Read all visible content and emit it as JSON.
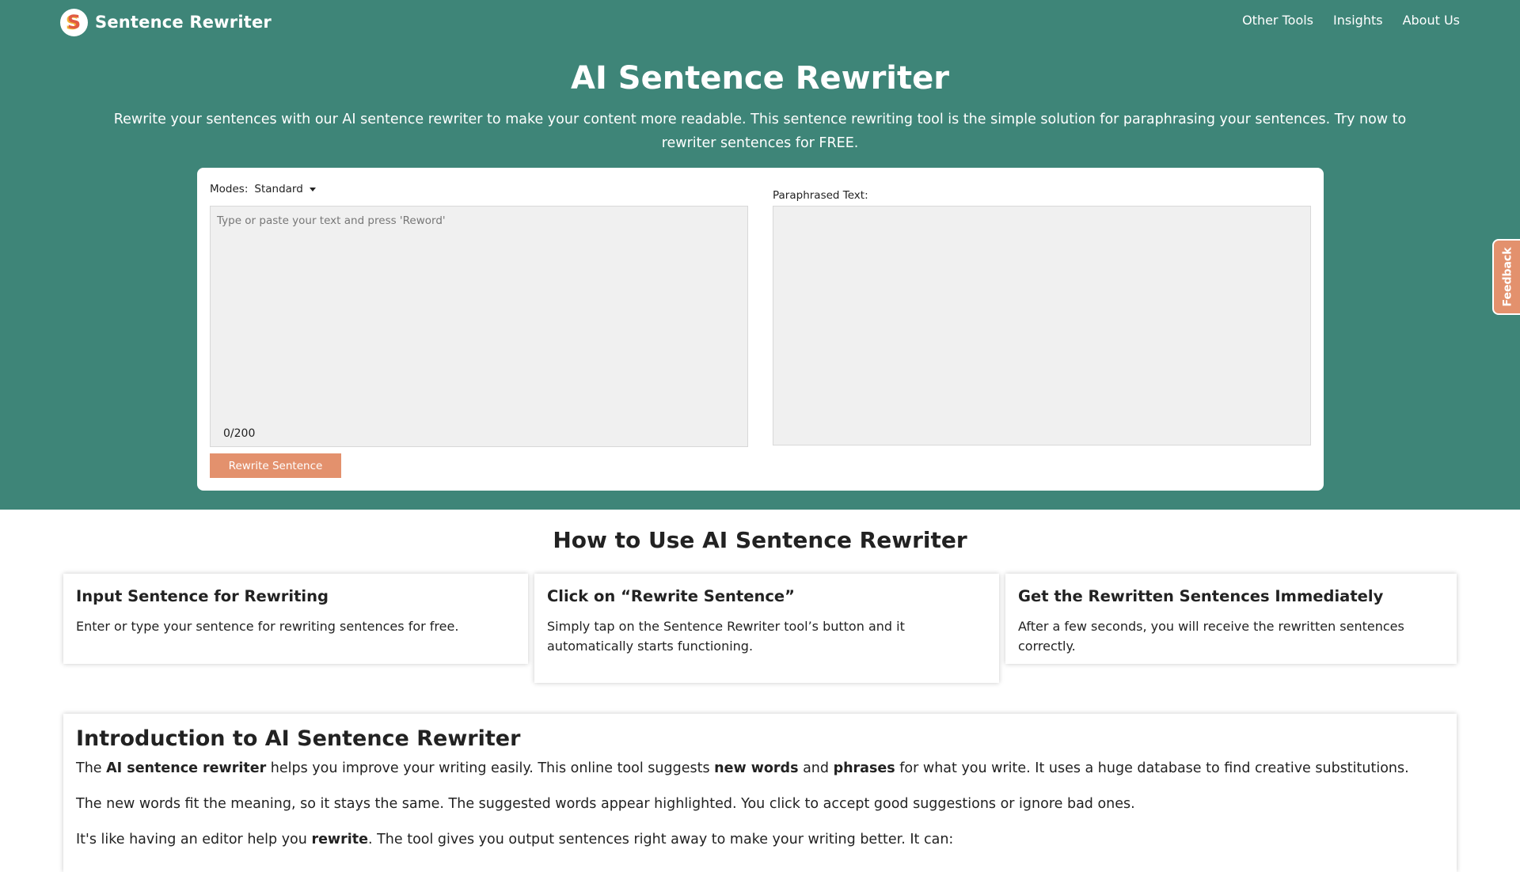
{
  "brand": {
    "logo_letter": "S",
    "name": "Sentence Rewriter"
  },
  "nav": {
    "links": [
      "Other Tools",
      "Insights",
      "About Us"
    ]
  },
  "hero": {
    "title": "AI Sentence Rewriter",
    "subtitle": "Rewrite your sentences with our AI sentence rewriter to make your content more readable. This sentence rewriting tool is the simple solution for paraphrasing your sentences. Try now to rewriter sentences for FREE."
  },
  "tool": {
    "modes_label": "Modes:",
    "mode_value": "Standard",
    "input_placeholder": "Type or paste your text and press 'Reword'",
    "counter": "0/200",
    "output_label": "Paraphrased Text:",
    "rewrite_button": "Rewrite Sentence"
  },
  "feedback": {
    "label": "Feedback"
  },
  "how_to": {
    "title": "How to Use AI Sentence Rewriter",
    "steps": [
      {
        "title": "Input Sentence for Rewriting",
        "text": "Enter or type your sentence for rewriting sentences for free."
      },
      {
        "title": "Click on “Rewrite Sentence”",
        "text": "Simply tap on the Sentence Rewriter tool’s button and it automatically starts functioning."
      },
      {
        "title": "Get the Rewritten Sentences Immediately",
        "text": "After a few seconds, you will receive the rewritten sentences correctly."
      }
    ]
  },
  "intro": {
    "title": "Introduction to AI Sentence Rewriter",
    "p1": {
      "t1": "The ",
      "b1": "AI sentence rewriter",
      "t2": " helps you improve your writing easily. This online tool suggests ",
      "b2": "new words",
      "t3": " and ",
      "b3": "phrases",
      "t4": " for what you write. It uses a huge database to find creative substitutions."
    },
    "p2": "The new words fit the meaning, so it stays the same. The suggested words appear highlighted. You click to accept good suggestions or ignore bad ones.",
    "p3": {
      "t1": "It's like having an editor help you ",
      "b1": "rewrite",
      "t2": ". The tool gives you output sentences right away to make your writing better. It can:"
    }
  },
  "colors": {
    "hero_bg": "#3e8578",
    "accent": "#e3916d",
    "logo_red": "#e05a43",
    "logo_yellow": "#f1b235"
  }
}
